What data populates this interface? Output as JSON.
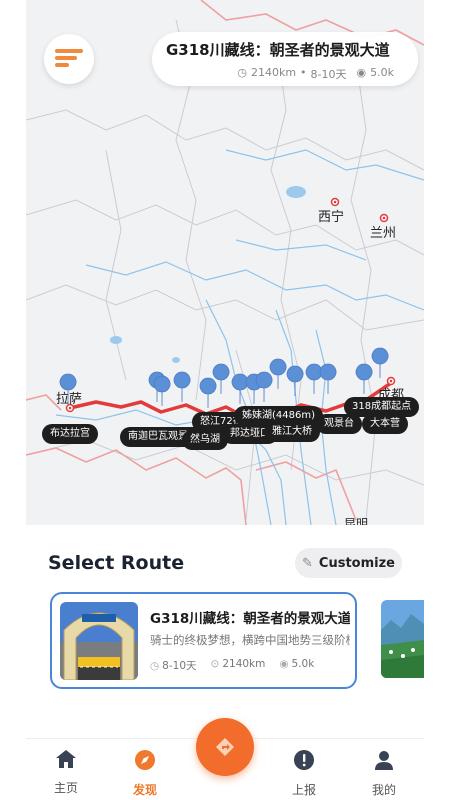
{
  "header": {
    "title": "G318川藏线：朝圣者的景观大道",
    "distance": "2140km",
    "separator": "•",
    "duration": "8-10天",
    "views": "5.0k"
  },
  "map": {
    "cities": [
      {
        "name": "西宁"
      },
      {
        "name": "兰州"
      },
      {
        "name": "拉萨"
      },
      {
        "name": "成都"
      },
      {
        "name": "昆明"
      }
    ],
    "labels": {
      "potala": "布达拉宫",
      "namjagbarwa": "南迦巴瓦观景台",
      "bend72": "怒江72拐",
      "lake": "然乌湖",
      "pass": "邦达垭口",
      "sister_lake": "姊妹湖(4486m)",
      "bridge": "雅江大桥",
      "view": "观景台",
      "base": "大本营",
      "start": "318成都起点"
    },
    "colors": {
      "route": "#e23b3b",
      "pin": "#5b8fd6",
      "river": "#8ec3ea",
      "border": "#f0a0a0"
    }
  },
  "section": {
    "title": "Select Route",
    "customize": "Customize"
  },
  "routes": [
    {
      "title": "G318川藏线：朝圣者的景观大道",
      "desc": "骑士的终极梦想，横跨中国地势三级阶梯",
      "duration": "8-10天",
      "distance": "2140km",
      "views": "5.0k"
    }
  ],
  "nav": {
    "home": "主页",
    "discover": "发现",
    "report": "上报",
    "mine": "我的",
    "active": "发现",
    "accent": "#ef7a2e"
  }
}
